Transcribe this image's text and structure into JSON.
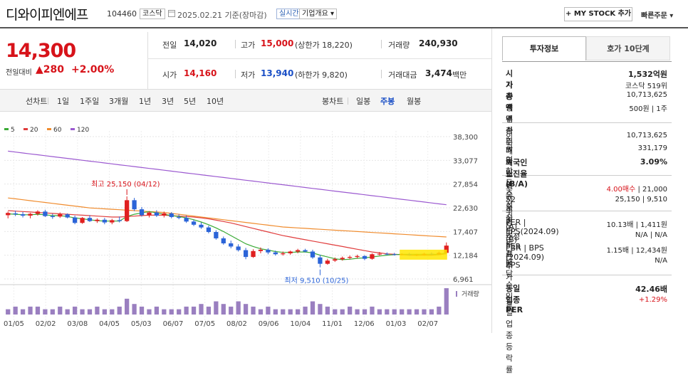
{
  "header": {
    "stock_name": "디와이피엔에프",
    "stock_code": "104460",
    "market_tag": "코스닥",
    "date_text": "2025.02.21 기준(장마감)",
    "realtime_tag": "실시간",
    "company_info_tag": "기업개요 ▾",
    "mystock_label": "+ MY STOCK 추가",
    "quick_order_label": "빠른주문 ▾"
  },
  "quote": {
    "price": "14,300",
    "change_label": "전일대비",
    "change_value": "▲280",
    "change_pct": "+2.00%",
    "prev_close_label": "전일",
    "prev_close": "14,020",
    "high_label": "고가",
    "high": "15,000",
    "high_note": "(상한가 18,220)",
    "volume_label": "거래량",
    "volume": "240,930",
    "open_label": "시가",
    "open": "14,160",
    "low_label": "저가",
    "low": "13,940",
    "low_note": "(하한가 9,820)",
    "value_label": "거래대금",
    "value": "3,474",
    "value_unit": "백만"
  },
  "toolbar": {
    "line_chart": "선차트",
    "periods": [
      "1일",
      "1주일",
      "3개월",
      "1년",
      "3년",
      "5년",
      "10년"
    ],
    "candle_chart": "봉차트",
    "candle_periods": [
      "일봉",
      "주봉",
      "월봉"
    ],
    "active_candle": "주봉"
  },
  "panel": {
    "tab_invest": "투자정보",
    "tab_quote": "호가 10단계",
    "rows1": [
      {
        "label": "시가총액",
        "value": "1,532억원",
        "bold": true
      },
      {
        "label": "시가총액순위",
        "value": "코스닥 519위"
      },
      {
        "label": "상장주식수",
        "value": "10,713,625"
      },
      {
        "label": "액면가 | 매매단위",
        "value": "500원 | 1주"
      }
    ],
    "rows2": [
      {
        "label": "외국인한도주식수(A)",
        "value": "10,713,625"
      },
      {
        "label": "외국인보유주식수(B)",
        "value": "331,179"
      },
      {
        "label": "외국인소진율(B/A)",
        "value": "3.09%",
        "bold": true
      }
    ],
    "rows3": [
      {
        "label": "투자의견 | 목표주가",
        "value_red": "4.00매수",
        "value": " | 21,000"
      },
      {
        "label": "52주최고 | 최저",
        "value": "25,150 | 9,510"
      }
    ],
    "rows4": [
      {
        "label": "PER | EPS(2024.09)",
        "value": "10.13배 | 1,411원"
      },
      {
        "label": "추정PER | EPS",
        "value": "N/A | N/A"
      },
      {
        "label": "PBR | BPS (2024.09)",
        "value": "1.15배 | 12,434원"
      },
      {
        "label": "배당수익률",
        "value": "N/A"
      }
    ],
    "rows5": [
      {
        "label": "동일업종 PER",
        "value": "42.46배",
        "bold": true
      },
      {
        "label": "동일업종 등락률",
        "value": "+1.29%",
        "red": true
      }
    ]
  },
  "chart_data": {
    "type": "candlestick",
    "legend": [
      {
        "name": "5",
        "color": "#3aaa35"
      },
      {
        "name": "20",
        "color": "#e03c3c"
      },
      {
        "name": "60",
        "color": "#f08c2e"
      },
      {
        "name": "120",
        "color": "#9b59d0"
      }
    ],
    "y_ticks": [
      38300,
      33077,
      27854,
      22630,
      17407,
      12184,
      6961
    ],
    "ylim": [
      6961,
      38300
    ],
    "x_labels": [
      "01/05",
      "02/02",
      "03/08",
      "04/05",
      "05/03",
      "06/07",
      "07/05",
      "08/02",
      "09/06",
      "10/04",
      "11/01",
      "12/06",
      "01/03",
      "02/07"
    ],
    "annotations": [
      {
        "text": "최고 25,150 (04/12)"
      },
      {
        "text": "최저 9,510 (10/25)"
      }
    ],
    "volume_label": "거래량",
    "candles": [
      {
        "o": 21000,
        "h": 21800,
        "l": 20300,
        "c": 21500
      },
      {
        "o": 21400,
        "h": 22000,
        "l": 20800,
        "c": 21200
      },
      {
        "o": 21200,
        "h": 21700,
        "l": 20500,
        "c": 20900
      },
      {
        "o": 20900,
        "h": 21500,
        "l": 20300,
        "c": 21300
      },
      {
        "o": 21300,
        "h": 22100,
        "l": 20900,
        "c": 21800
      },
      {
        "o": 21800,
        "h": 22200,
        "l": 20600,
        "c": 20800
      },
      {
        "o": 20800,
        "h": 21300,
        "l": 20200,
        "c": 20600
      },
      {
        "o": 20700,
        "h": 21600,
        "l": 20400,
        "c": 21200
      },
      {
        "o": 21200,
        "h": 21400,
        "l": 20300,
        "c": 20500
      },
      {
        "o": 20500,
        "h": 20900,
        "l": 19000,
        "c": 19300
      },
      {
        "o": 19300,
        "h": 20600,
        "l": 19100,
        "c": 20400
      },
      {
        "o": 20400,
        "h": 21000,
        "l": 19500,
        "c": 19700
      },
      {
        "o": 19700,
        "h": 20300,
        "l": 19300,
        "c": 20000
      },
      {
        "o": 20000,
        "h": 20400,
        "l": 19000,
        "c": 19400
      },
      {
        "o": 19400,
        "h": 20200,
        "l": 19000,
        "c": 19900
      },
      {
        "o": 19900,
        "h": 20700,
        "l": 19400,
        "c": 19700
      },
      {
        "o": 19700,
        "h": 25150,
        "l": 19500,
        "c": 24300
      },
      {
        "o": 24300,
        "h": 24800,
        "l": 21900,
        "c": 22300
      },
      {
        "o": 22300,
        "h": 22800,
        "l": 20700,
        "c": 21000
      },
      {
        "o": 21000,
        "h": 21900,
        "l": 20500,
        "c": 21600
      },
      {
        "o": 21600,
        "h": 22100,
        "l": 20600,
        "c": 20900
      },
      {
        "o": 20900,
        "h": 21800,
        "l": 20500,
        "c": 21400
      },
      {
        "o": 21400,
        "h": 21700,
        "l": 20300,
        "c": 20600
      },
      {
        "o": 20600,
        "h": 21200,
        "l": 20100,
        "c": 20400
      },
      {
        "o": 20400,
        "h": 20900,
        "l": 19300,
        "c": 19600
      },
      {
        "o": 19600,
        "h": 20000,
        "l": 18600,
        "c": 18900
      },
      {
        "o": 18900,
        "h": 19400,
        "l": 18000,
        "c": 18300
      },
      {
        "o": 18300,
        "h": 18700,
        "l": 17000,
        "c": 17300
      },
      {
        "o": 17300,
        "h": 17700,
        "l": 15600,
        "c": 15900
      },
      {
        "o": 15900,
        "h": 16300,
        "l": 14500,
        "c": 14800
      },
      {
        "o": 14800,
        "h": 15400,
        "l": 13700,
        "c": 14100
      },
      {
        "o": 14100,
        "h": 14600,
        "l": 13000,
        "c": 13300
      },
      {
        "o": 13300,
        "h": 13800,
        "l": 11300,
        "c": 11800
      },
      {
        "o": 11800,
        "h": 13500,
        "l": 11600,
        "c": 13100
      },
      {
        "o": 13100,
        "h": 13900,
        "l": 12600,
        "c": 13400
      },
      {
        "o": 13400,
        "h": 13700,
        "l": 12400,
        "c": 12800
      },
      {
        "o": 12800,
        "h": 13200,
        "l": 12100,
        "c": 12400
      },
      {
        "o": 12400,
        "h": 13000,
        "l": 12100,
        "c": 12600
      },
      {
        "o": 12600,
        "h": 13200,
        "l": 12300,
        "c": 13000
      },
      {
        "o": 13000,
        "h": 13600,
        "l": 12600,
        "c": 13300
      },
      {
        "o": 13300,
        "h": 13600,
        "l": 12800,
        "c": 13000
      },
      {
        "o": 13000,
        "h": 13400,
        "l": 11400,
        "c": 11700
      },
      {
        "o": 11700,
        "h": 12300,
        "l": 9510,
        "c": 10300
      },
      {
        "o": 10300,
        "h": 11400,
        "l": 10100,
        "c": 11000
      },
      {
        "o": 11000,
        "h": 11700,
        "l": 10700,
        "c": 11300
      },
      {
        "o": 11300,
        "h": 11900,
        "l": 11000,
        "c": 11600
      },
      {
        "o": 11600,
        "h": 12100,
        "l": 11300,
        "c": 11800
      },
      {
        "o": 11800,
        "h": 12300,
        "l": 11500,
        "c": 12000
      },
      {
        "o": 12000,
        "h": 12200,
        "l": 11100,
        "c": 11400
      },
      {
        "o": 11400,
        "h": 12600,
        "l": 11200,
        "c": 12400
      },
      {
        "o": 12400,
        "h": 12900,
        "l": 12100,
        "c": 12500
      },
      {
        "o": 12500,
        "h": 12800,
        "l": 12200,
        "c": 12400
      },
      {
        "o": 12400,
        "h": 12700,
        "l": 12100,
        "c": 12300
      },
      {
        "o": 12300,
        "h": 12600,
        "l": 12100,
        "c": 12400
      },
      {
        "o": 12400,
        "h": 12700,
        "l": 12100,
        "c": 12200
      },
      {
        "o": 12200,
        "h": 12500,
        "l": 12000,
        "c": 12300
      },
      {
        "o": 12300,
        "h": 12700,
        "l": 12100,
        "c": 12500
      },
      {
        "o": 12500,
        "h": 12800,
        "l": 12200,
        "c": 12400
      },
      {
        "o": 12400,
        "h": 13000,
        "l": 12200,
        "c": 12700
      },
      {
        "o": 12700,
        "h": 15000,
        "l": 12500,
        "c": 14300
      }
    ],
    "ma5": [
      21300,
      21200,
      21100,
      21100,
      21200,
      21100,
      20900,
      20900,
      20700,
      20400,
      20200,
      20000,
      19800,
      19700,
      19700,
      19700,
      20700,
      21200,
      21500,
      21800,
      21500,
      21200,
      20900,
      20700,
      20400,
      20000,
      19500,
      18900,
      18200,
      17400,
      16500,
      15600,
      14700,
      14100,
      13600,
      13300,
      13000,
      12800,
      12800,
      12900,
      12900,
      12700,
      12200,
      11800,
      11400,
      11200,
      11300,
      11500,
      11600,
      11800,
      12000,
      12200,
      12300,
      12400,
      12400,
      12400,
      12400,
      12400,
      12400,
      12700
    ],
    "ma20": [
      22000,
      21900,
      21800,
      21700,
      21600,
      21500,
      21400,
      21300,
      21200,
      21100,
      21000,
      20900,
      20800,
      20700,
      20600,
      20600,
      20700,
      20800,
      20900,
      21000,
      21000,
      21000,
      20900,
      20800,
      20700,
      20600,
      20400,
      20200,
      19900,
      19600,
      19300,
      18900,
      18500,
      18100,
      17700,
      17300,
      16900,
      16500,
      16200,
      15900,
      15600,
      15300,
      15000,
      14700,
      14400,
      14100,
      13800,
      13500,
      13200,
      12900,
      12700,
      12500,
      12400,
      12300,
      12200,
      12200,
      12200,
      12200,
      12300,
      12500
    ],
    "ma60": [
      24800,
      24600,
      24400,
      24200,
      24000,
      23800,
      23600,
      23400,
      23200,
      23000,
      22800,
      22600,
      22500,
      22400,
      22300,
      22200,
      22100,
      22000,
      21900,
      21800,
      21700,
      21600,
      21400,
      21200,
      21000,
      20800,
      20600,
      20400,
      20200,
      20000,
      19800,
      19600,
      19400,
      19200,
      19000,
      18800,
      18600,
      18400,
      18300,
      18200,
      18100,
      18000,
      17900,
      17800,
      17700,
      17600,
      17500,
      17400,
      17300,
      17200,
      17100,
      17000,
      16900,
      16800,
      16700,
      16600,
      16500,
      16400,
      16300,
      16200
    ],
    "ma120": [
      35100,
      34900,
      34700,
      34500,
      34300,
      34100,
      33900,
      33700,
      33500,
      33300,
      33100,
      32900,
      32700,
      32500,
      32300,
      32100,
      31900,
      31700,
      31500,
      31300,
      31100,
      30900,
      30700,
      30500,
      30300,
      30100,
      29900,
      29700,
      29500,
      29300,
      29100,
      28900,
      28700,
      28500,
      28300,
      28100,
      27900,
      27700,
      27500,
      27300,
      27100,
      26900,
      26700,
      26500,
      26300,
      26100,
      25900,
      25700,
      25500,
      25300,
      25100,
      24900,
      24700,
      24500,
      24300,
      24100,
      23900,
      23700,
      23500,
      23300
    ],
    "volume": [
      2,
      3,
      2,
      3,
      3,
      2,
      2,
      3,
      2,
      3,
      2,
      2,
      3,
      2,
      2,
      3,
      6,
      4,
      3,
      2,
      3,
      2,
      2,
      2,
      3,
      3,
      4,
      3,
      5,
      4,
      3,
      5,
      4,
      3,
      2,
      3,
      2,
      2,
      2,
      2,
      3,
      5,
      4,
      3,
      2,
      2,
      3,
      2,
      2,
      3,
      2,
      2,
      2,
      2,
      2,
      2,
      2,
      2,
      3,
      10
    ]
  }
}
